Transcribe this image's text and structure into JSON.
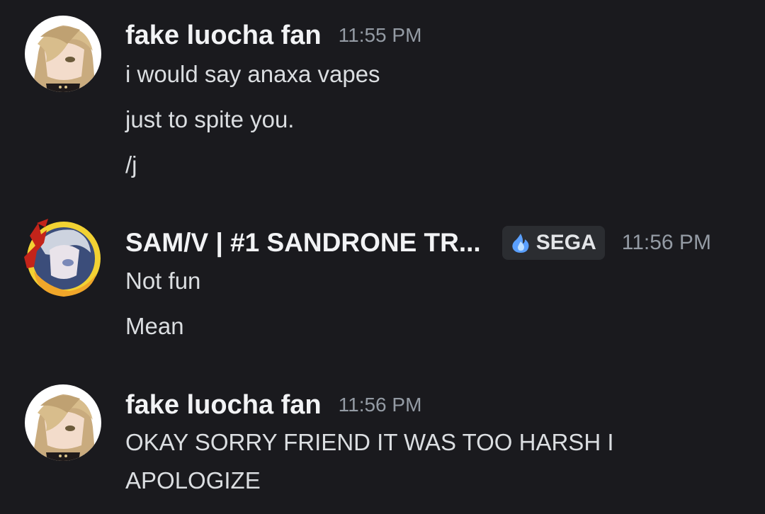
{
  "messages": [
    {
      "author": "fake luocha fan",
      "timestamp": "11:55 PM",
      "lines": [
        "i would say anaxa vapes",
        "just to spite you.",
        "/j"
      ]
    },
    {
      "author": "SAM/V | #1 SANDRONE TR...",
      "tag": "SEGA",
      "tag_icon": "blue-flame-icon",
      "timestamp": "11:56 PM",
      "lines": [
        "Not fun",
        "Mean"
      ]
    },
    {
      "author": "fake luocha fan",
      "timestamp": "11:56 PM",
      "lines": [
        "OKAY SORRY FRIEND IT WAS TOO HARSH I",
        "APOLOGIZE"
      ]
    }
  ],
  "colors": {
    "background": "#1a1a1e",
    "username": "#f2f3f5",
    "text": "#dbdee1",
    "timestamp": "#949ba4",
    "tag_bg": "#2b2d31",
    "tag_icon": "#5aa0ff"
  }
}
